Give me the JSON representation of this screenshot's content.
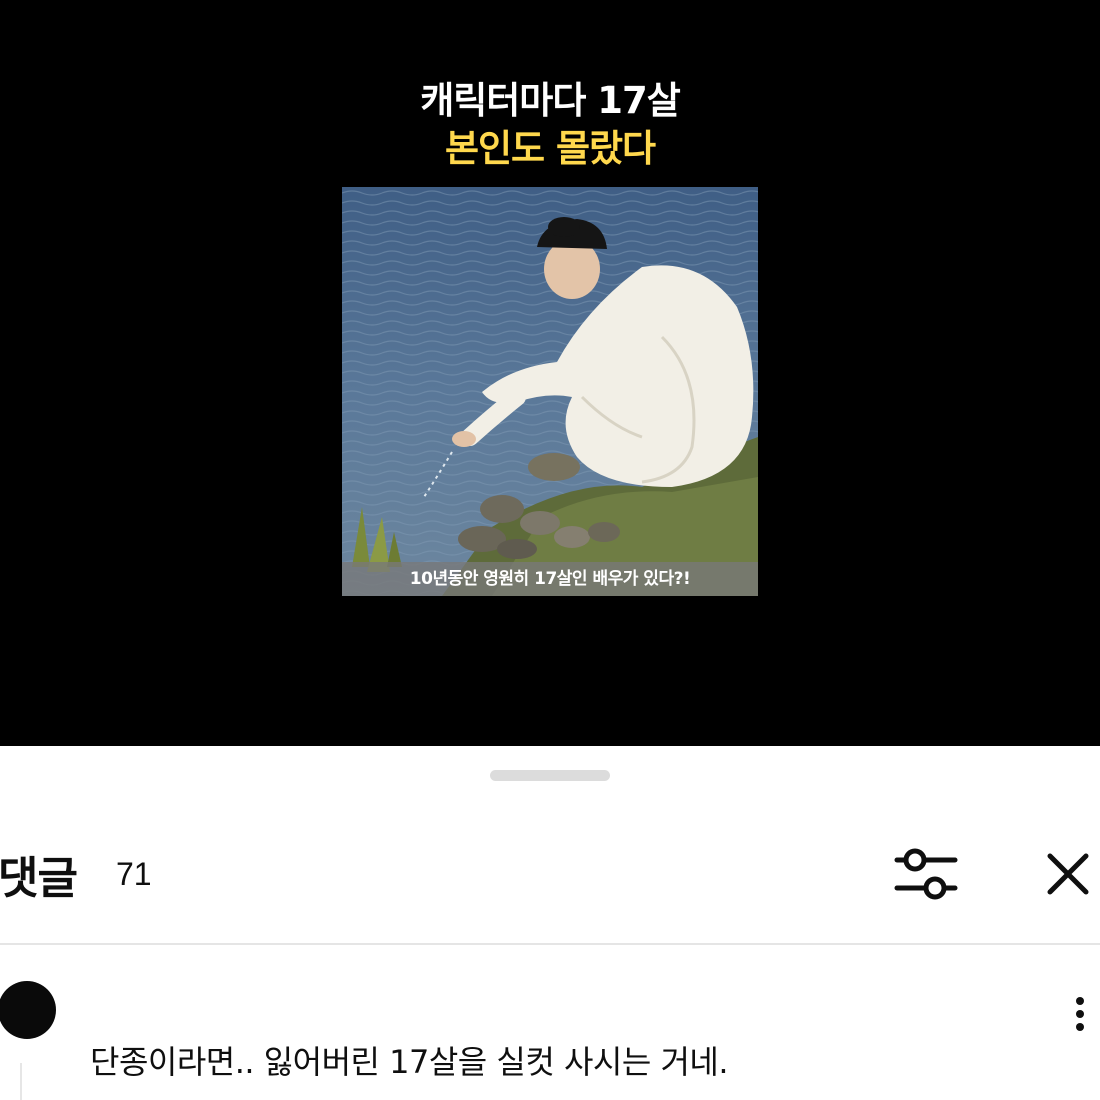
{
  "video": {
    "headline_line1": "캐릭터마다 17살",
    "headline_line2": "본인도 몰랐다",
    "headline_line2_color": "#ffd84d",
    "photo_caption": "10년동안 영원히 17살인 배우가 있다?!"
  },
  "comments_panel": {
    "title": "댓글",
    "count": "71",
    "filter_icon": "sliders-icon",
    "close_icon": "close-icon"
  },
  "comments": [
    {
      "author": "",
      "text": "단종이라면.. 잃어버린 17살을 실컷 사시는 거네.",
      "menu_icon": "more-vertical-icon"
    }
  ]
}
